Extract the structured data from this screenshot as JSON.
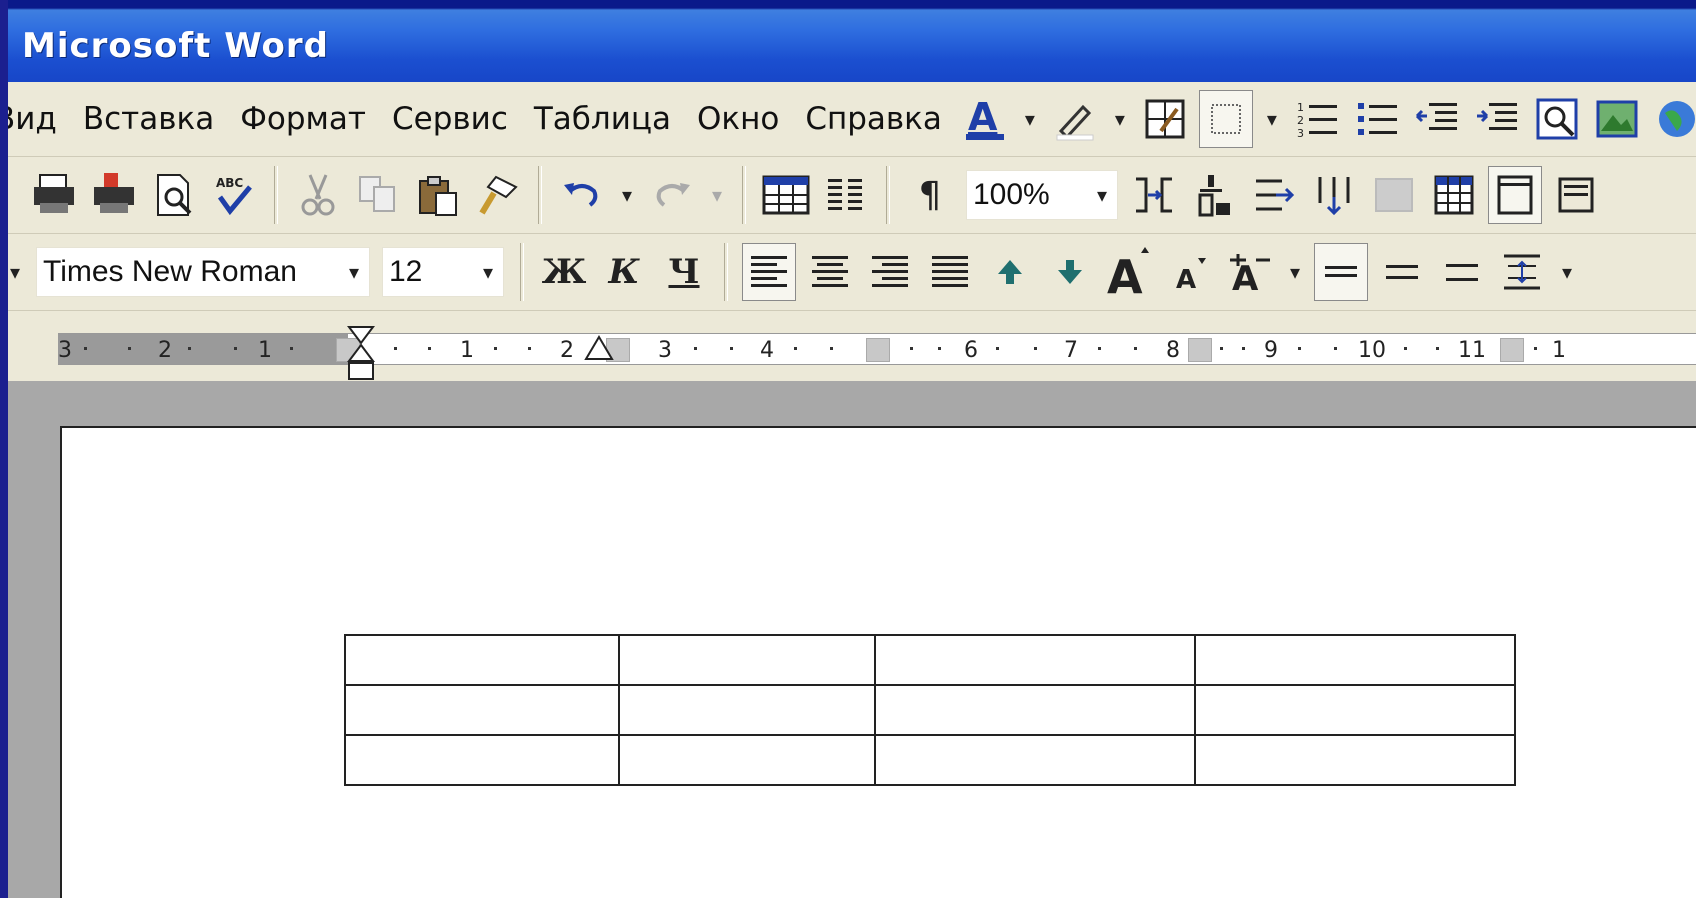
{
  "window": {
    "title": "Microsoft Word"
  },
  "menu": {
    "items": [
      {
        "label": "Вид"
      },
      {
        "label": "Вставка"
      },
      {
        "label": "Формат"
      },
      {
        "label": "Сервис"
      },
      {
        "label": "Таблица"
      },
      {
        "label": "Окно"
      },
      {
        "label": "Справка"
      }
    ]
  },
  "standard_toolbar": {
    "zoom": "100%"
  },
  "formatting_toolbar": {
    "font_name": "Times New Roman",
    "font_size": "12",
    "bold_label": "Ж",
    "italic_label": "К",
    "underline_label": "Ч"
  },
  "ruler": {
    "labels": [
      "3",
      "2",
      "1",
      "1",
      "2",
      "3",
      "4",
      "6",
      "7",
      "8",
      "9",
      "10",
      "11",
      "1"
    ]
  },
  "document": {
    "table": {
      "rows": 3,
      "columns": 4
    }
  }
}
